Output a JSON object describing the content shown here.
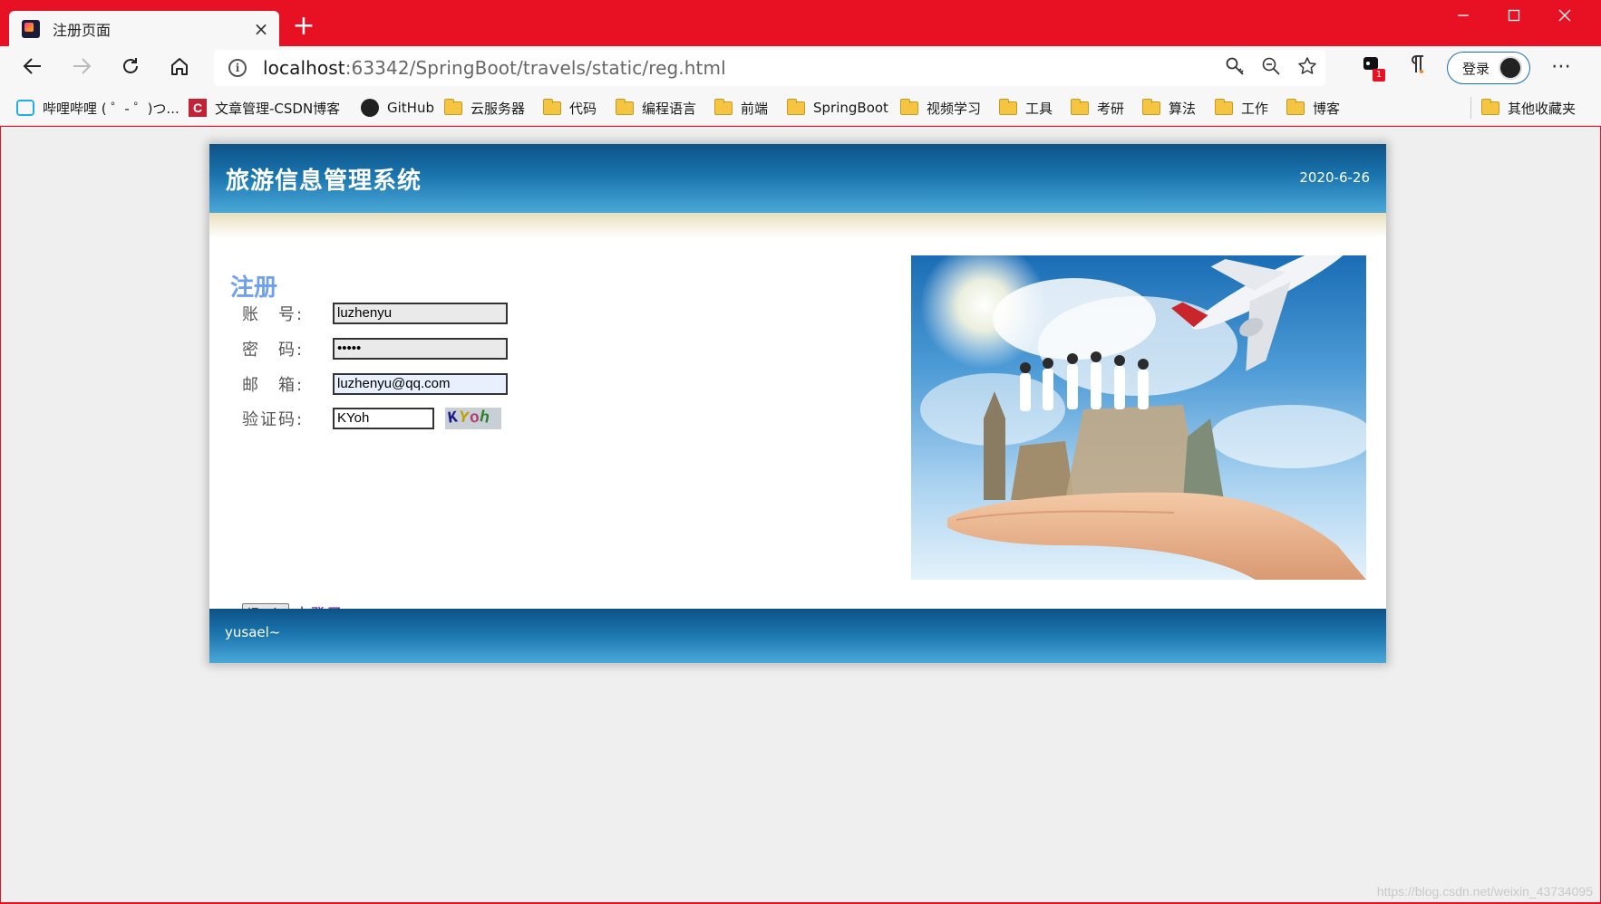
{
  "browser": {
    "tab_title": "注册页面",
    "tab_close": "×",
    "new_tab": "+",
    "url_host": "localhost",
    "url_rest": ":63342/SpringBoot/travels/static/reg.html",
    "signin_label": "登录",
    "extension_badge": "1",
    "accent": "#e81123"
  },
  "bookmarks": {
    "items": [
      {
        "label": "哔哩哔哩 ( ゜- ゜)つ...",
        "icon": "bilibili-icon"
      },
      {
        "label": "文章管理-CSDN博客",
        "icon": "csdn-icon"
      },
      {
        "label": "GitHub",
        "icon": "github-icon"
      },
      {
        "label": "云服务器",
        "icon": "folder-icon"
      },
      {
        "label": "代码",
        "icon": "folder-icon"
      },
      {
        "label": "编程语言",
        "icon": "folder-icon"
      },
      {
        "label": "前端",
        "icon": "folder-icon"
      },
      {
        "label": "SpringBoot",
        "icon": "folder-icon"
      },
      {
        "label": "视频学习",
        "icon": "folder-icon"
      },
      {
        "label": "工具",
        "icon": "folder-icon"
      },
      {
        "label": "考研",
        "icon": "folder-icon"
      },
      {
        "label": "算法",
        "icon": "folder-icon"
      },
      {
        "label": "工作",
        "icon": "folder-icon"
      },
      {
        "label": "博客",
        "icon": "folder-icon"
      }
    ],
    "other": "其他收藏夹"
  },
  "page": {
    "site_title": "旅游信息管理系统",
    "date": "2020-6-26",
    "register_title": "注册",
    "form": {
      "account_label": "账　号:",
      "account_value": "luzhenyu",
      "password_label": "密　码:",
      "password_value": "•••••",
      "email_label": "邮　箱:",
      "email_value": "luzhenyu@qq.com",
      "code_label": "验证码:",
      "code_value": "KYoh",
      "captcha_text": "KYoh"
    },
    "submit_label": "提 交",
    "login_link": "去登录",
    "footer_text": "yusael~",
    "header_color": "#1a74ad",
    "title_color": "#6f9ff0"
  },
  "watermark": "https://blog.csdn.net/weixin_43734095"
}
